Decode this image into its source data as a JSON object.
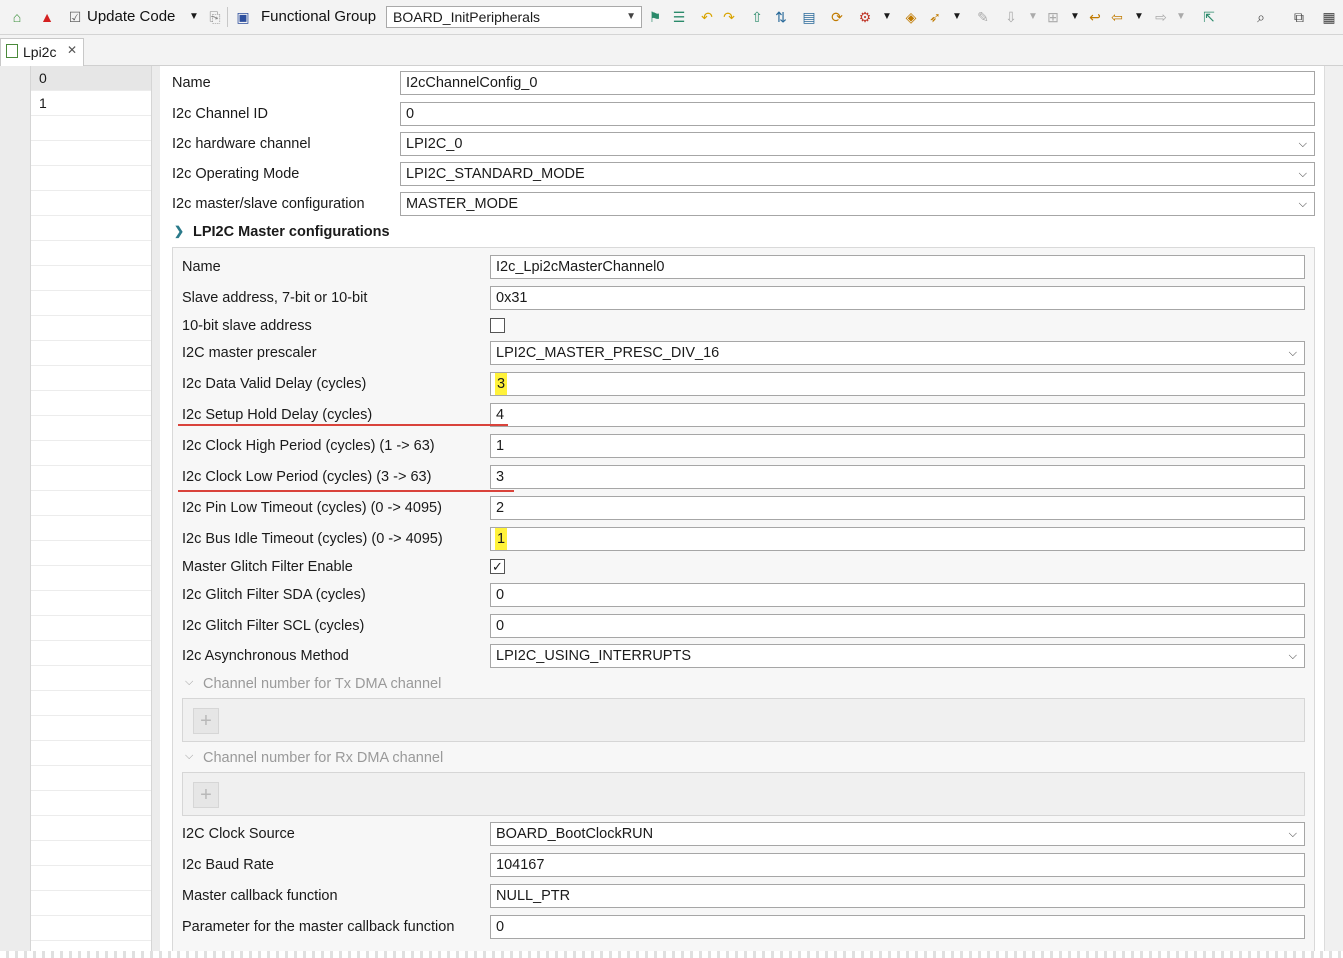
{
  "toolbar": {
    "update_code_label": "Update Code",
    "functional_group_label": "Functional Group",
    "functional_group_value": "BOARD_InitPeripherals"
  },
  "tab": {
    "label": "Lpi2c"
  },
  "index_list": {
    "items": [
      "0",
      "1"
    ]
  },
  "channel": {
    "name_label": "Name",
    "name_value": "I2cChannelConfig_0",
    "id_label": "I2c Channel ID",
    "id_value": "0",
    "hw_label": "I2c hardware channel",
    "hw_value": "LPI2C_0",
    "mode_label": "I2c Operating Mode",
    "mode_value": "LPI2C_STANDARD_MODE",
    "ms_label": "I2c master/slave configuration",
    "ms_value": "MASTER_MODE"
  },
  "master": {
    "header": "LPI2C Master configurations",
    "name_label": "Name",
    "name_value": "I2c_Lpi2cMasterChannel0",
    "slave_label": "Slave address, 7-bit or 10-bit",
    "slave_value": "0x31",
    "tenbit_label": "10-bit slave address",
    "prescaler_label": "I2C master prescaler",
    "prescaler_value": "LPI2C_MASTER_PRESC_DIV_16",
    "dvd_label": "I2c Data Valid Delay (cycles)",
    "dvd_value": "3",
    "shd_label": "I2c Setup Hold Delay (cycles)",
    "shd_value": "4",
    "chp_label": "I2c Clock High Period (cycles) (1 -> 63)",
    "chp_value": "1",
    "clp_label": "I2c Clock Low Period (cycles) (3 -> 63)",
    "clp_value": "3",
    "plt_label": "I2c Pin Low Timeout (cycles) (0 -> 4095)",
    "plt_value": "2",
    "bit_label": "I2c Bus Idle Timeout (cycles) (0 -> 4095)",
    "bit_value": "1",
    "mgf_label": "Master Glitch Filter Enable",
    "sda_label": "I2c Glitch Filter SDA (cycles)",
    "sda_value": "0",
    "scl_label": "I2c Glitch Filter SCL (cycles)",
    "scl_value": "0",
    "async_label": "I2c Asynchronous Method",
    "async_value": "LPI2C_USING_INTERRUPTS",
    "txdma_label": "Channel number for Tx DMA channel",
    "rxdma_label": "Channel number for Rx DMA channel",
    "clksrc_label": "I2C Clock Source",
    "clksrc_value": "BOARD_BootClockRUN",
    "baud_label": "I2c Baud Rate",
    "baud_value": "104167",
    "cb_label": "Master callback function",
    "cb_value": "NULL_PTR",
    "cbparam_label": "Parameter for the master callback function",
    "cbparam_value": "0"
  },
  "icons": {
    "toolbar": [
      "home-icon",
      "error-icon",
      "checkbox-icon",
      "dropdown-arrow-icon",
      "copy-icon",
      "component-icon",
      "flag-icon",
      "list-icon",
      "undo-icon",
      "redo-icon",
      "upload-icon",
      "sort-icon",
      "save-icon",
      "refresh-icon",
      "gear-icon",
      "layers-icon",
      "rocket-icon",
      "pen-icon",
      "stack-icon",
      "filter-icon",
      "back-icon",
      "left-arrow-icon",
      "right-arrow-icon",
      "export-icon",
      "search-icon",
      "window-icon",
      "perspective-icon"
    ]
  },
  "colors": {
    "highlight": "#fff23a",
    "underline": "#d9433b"
  },
  "checkboxes": {
    "tenbit_checked": false,
    "mgf_checked": true
  }
}
